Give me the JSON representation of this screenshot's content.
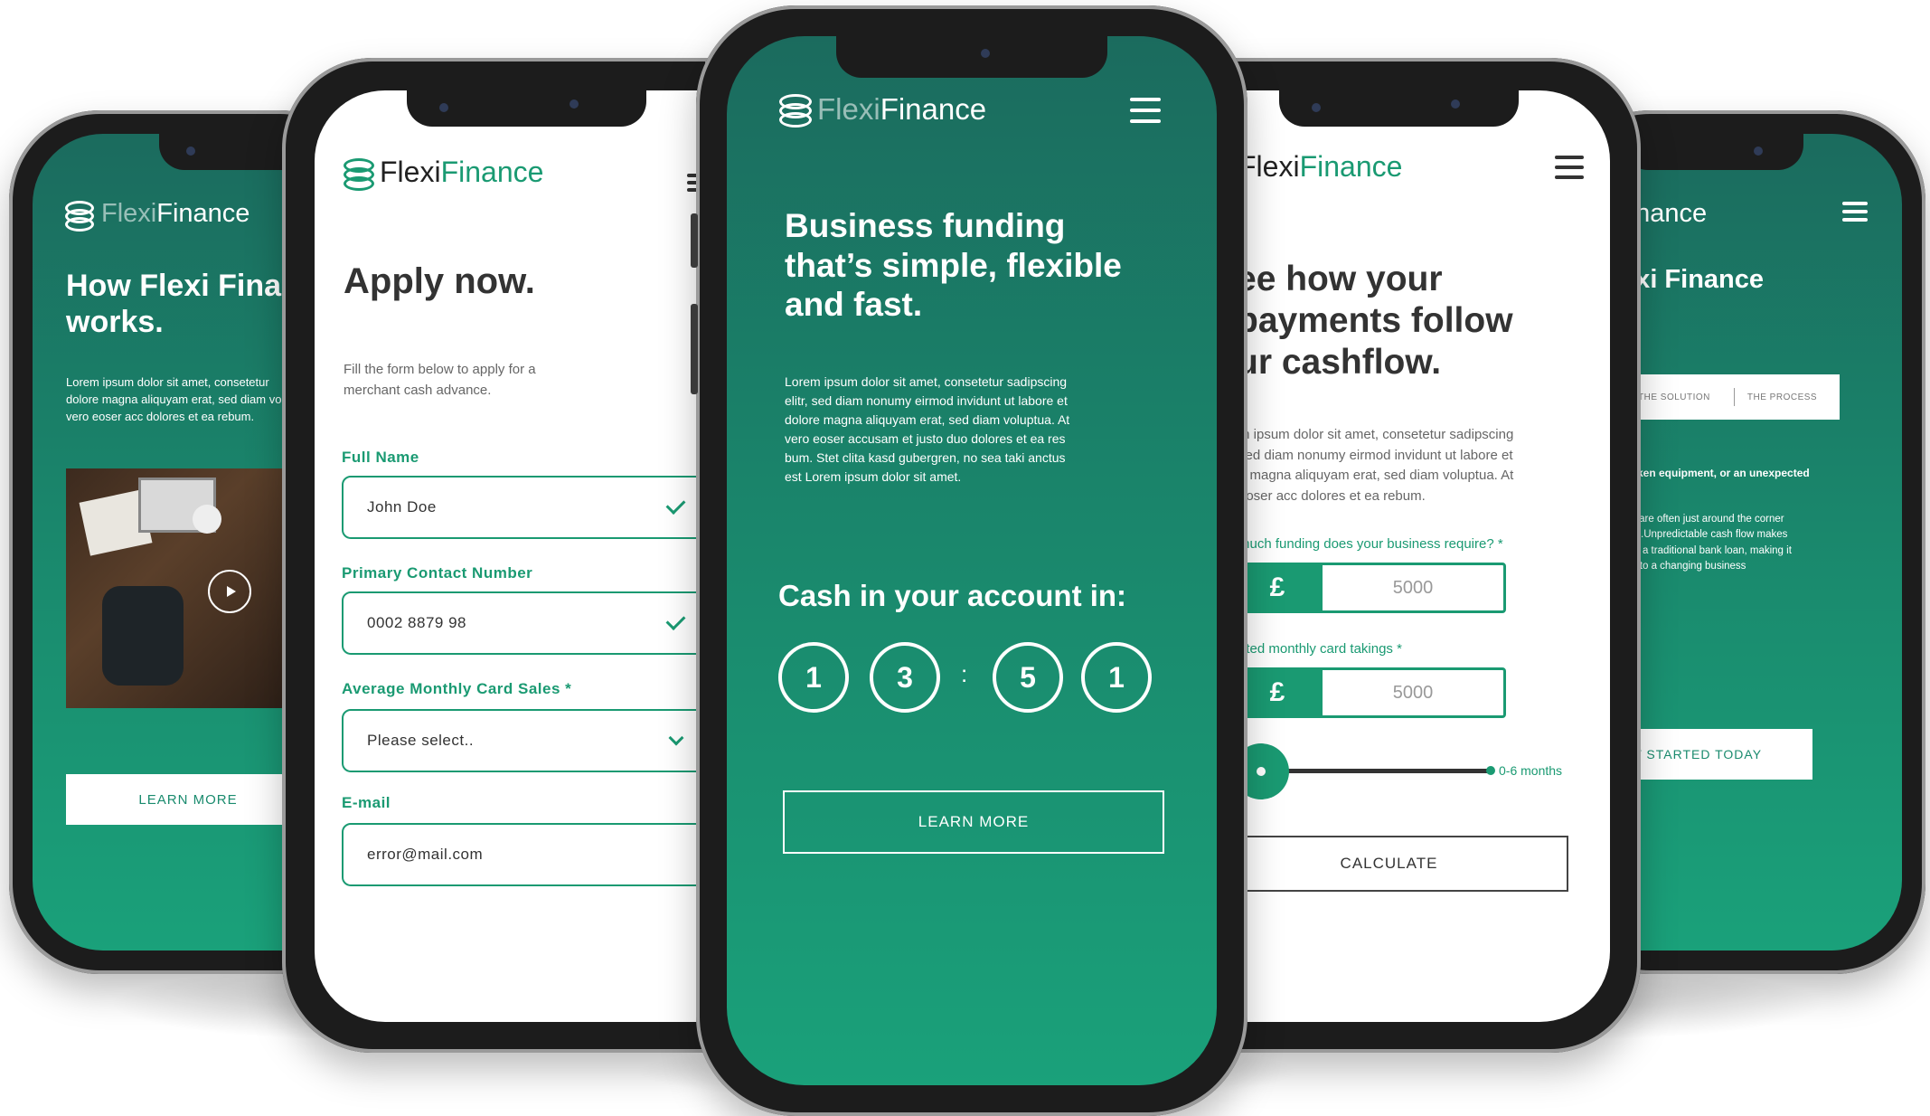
{
  "brand": {
    "name_part1": "Flexi",
    "name_part2": "Finance",
    "green": "#1a8b6e",
    "green_dark": "#1b6b5e",
    "green_text": "#1a9a72"
  },
  "phone_far_left": {
    "heading": "How Flexi Finan works.",
    "heading_line1": "How Flexi Finan",
    "heading_line2": "works.",
    "body": "Lorem ipsum dolor sit amet, consetetur dolore magna aliquyam erat, sed diam vo vero eoser acc dolores et ea rebum.",
    "body_line1": "Lorem ipsum dolor sit amet, consetetur",
    "body_line2": "dolore magna aliquyam erat, sed diam vo",
    "body_line3": "vero eoser acc dolores et ea rebum.",
    "photo_icon": "play-icon",
    "button": "LEARN MORE"
  },
  "phone_left": {
    "heading": "Apply now.",
    "intro_line1": "Fill the form below to apply for a",
    "intro_line2": "merchant cash advance.",
    "fields": [
      {
        "label": "Full Name",
        "value": "John Doe",
        "state": "valid"
      },
      {
        "label": "Primary Contact Number",
        "value": "0002 8879 98",
        "state": "valid"
      },
      {
        "label": "Average Monthly Card Sales *",
        "value": "Please select..",
        "state": "select"
      },
      {
        "label": "E-mail",
        "value": "error@mail.com",
        "state": "error"
      }
    ]
  },
  "phone_center": {
    "heading_line1": "Business funding",
    "heading_line2": "that’s simple, flexible",
    "heading_line3": "and fast.",
    "body_lines": [
      "Lorem ipsum dolor sit amet, consetetur sadipscing",
      "elitr, sed diam nonumy eirmod invidunt ut labore et",
      "dolore magna aliquyam erat, sed diam voluptua. At",
      "vero eoser accusam et justo duo dolores et ea res",
      "bum. Stet clita kasd gubergren, no sea taki anctus",
      "est Lorem ipsum dolor sit amet."
    ],
    "countdown_title": "Cash in your account in:",
    "digits": [
      "1",
      "3",
      "5",
      "1"
    ],
    "separator": ":",
    "button": "LEARN MORE"
  },
  "phone_right": {
    "heading_line1": "ee how your",
    "heading_line2": "payments follow",
    "heading_line3": "ur cashflow.",
    "body_lines": [
      "m ipsum dolor sit amet, consetetur sadipscing",
      "sed diam nonumy eirmod invidunt ut labore et",
      "e magna aliquyam erat, sed diam voluptua. At",
      "eoser acc dolores et ea rebum."
    ],
    "q1": "much funding does your business require? *",
    "q1_symbol": "£",
    "q1_value": "5000",
    "q2": "ated monthly card takings *",
    "q2_symbol": "£",
    "q2_value": "5000",
    "slider_label": "0-6 months",
    "slider_fraction": 0.12,
    "button": "CALCULATE"
  },
  "phone_far_right": {
    "logo_text": "Finance",
    "heading": "lexi Finance",
    "tabs": [
      "E",
      "THE SOLUTION",
      "THE PROCESS"
    ],
    "bold_text": ", broken equipment, or an unexpected",
    "body_lines": [
      "hese are often just around the corner",
      "esses.Unpredictable cash flow makes",
      "ecure a traditional bank loan, making it",
      "pond to a changing business"
    ],
    "button": "GET STARTED TODAY"
  }
}
